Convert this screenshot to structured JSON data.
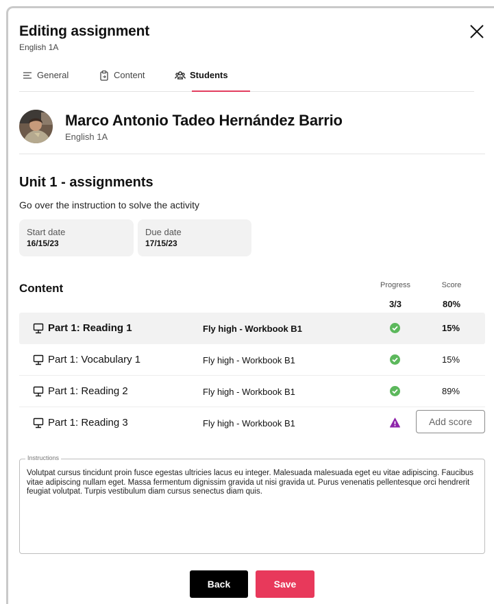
{
  "dialog": {
    "title": "Editing assignment",
    "subtitle": "English 1A"
  },
  "tabs": [
    {
      "label": "General",
      "icon": "list-lines-icon"
    },
    {
      "label": "Content",
      "icon": "clipboard-icon"
    },
    {
      "label": "Students",
      "icon": "users-icon"
    }
  ],
  "active_tab": "Students",
  "student": {
    "name": "Marco Antonio Tadeo Hernández Barrio",
    "class": "English 1A"
  },
  "unit": {
    "title": "Unit 1 - assignments",
    "description": "Go over the instruction to solve the  activity",
    "start_label": "Start date",
    "start_value": "16/15/23",
    "due_label": "Due date",
    "due_value": "17/15/23"
  },
  "content": {
    "title": "Content",
    "progress_label": "Progress",
    "score_label": "Score",
    "progress_total": "3/3",
    "score_total": "80%",
    "rows": [
      {
        "title": "Part 1: Reading 1",
        "book": "Fly high - Workbook B1",
        "status": "complete",
        "score": "15%"
      },
      {
        "title": "Part 1: Vocabulary 1",
        "book": "Fly high - Workbook B1",
        "status": "complete",
        "score": "15%"
      },
      {
        "title": "Part 1: Reading 2",
        "book": "Fly high - Workbook B1",
        "status": "complete",
        "score": "89%"
      },
      {
        "title": "Part 1: Reading 3",
        "book": "Fly high - Workbook B1",
        "status": "warning",
        "add_score_label": "Add score"
      }
    ]
  },
  "instructions": {
    "label": "Instructions",
    "text": "Volutpat cursus tincidunt proin fusce egestas ultricies lacus eu integer. Malesuada malesuada eget eu vitae adipiscing. Faucibus vitae adipiscing nullam eget. Massa fermentum dignissim gravida ut nisi gravida ut. Purus venenatis pellentesque orci hendrerit feugiat volutpat. Turpis vestibulum diam cursus senectus diam quis."
  },
  "actions": {
    "back_label": "Back",
    "save_label": "Save"
  },
  "colors": {
    "accent": "#e8395b",
    "success": "#5cb85c",
    "warning": "#8e24aa"
  }
}
